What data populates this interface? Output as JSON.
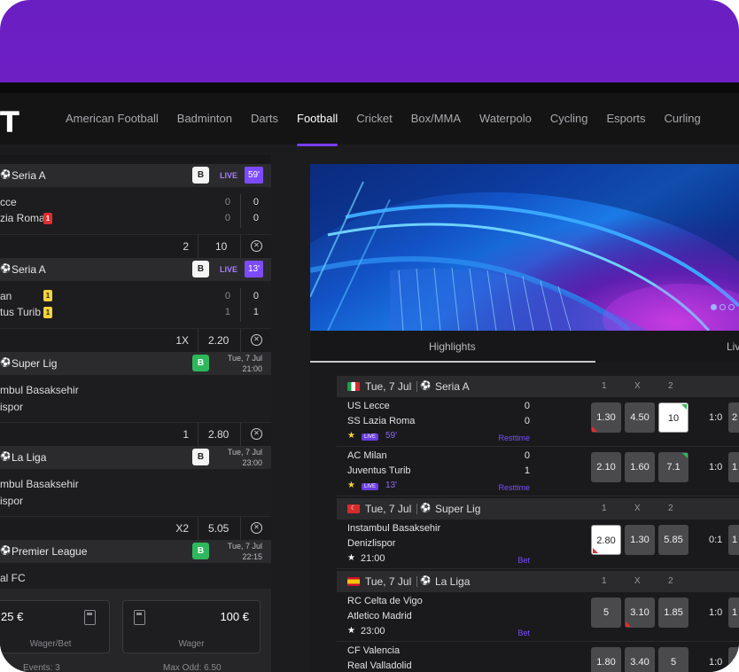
{
  "logo": "T",
  "nav": [
    "American Football",
    "Badminton",
    "Darts",
    "Football",
    "Cricket",
    "Box/MMA",
    "Waterpolo",
    "Cycling",
    "Esports",
    "Curling"
  ],
  "nav_active": "Football",
  "left_matches": [
    {
      "league": "Seria A",
      "tag": "B",
      "live": "LIVE",
      "minute": "59'",
      "team1": "cce",
      "team2": "zia Roma",
      "s1a": "0",
      "s1b": "0",
      "s2a": "0",
      "s2b": "0",
      "card2": "1",
      "sel": "2",
      "odd": "10"
    },
    {
      "league": "Seria A",
      "tag": "B",
      "live": "LIVE",
      "minute": "13'",
      "team1": "an",
      "team2": "tus Turib",
      "s1a": "0",
      "s1b": "0",
      "s2a": "1",
      "s2b": "1",
      "card1": "1",
      "card2": "1",
      "sel": "1X",
      "odd": "2.20"
    },
    {
      "league": "Super Lig",
      "tag": "B",
      "date": "Tue, 7 Jul",
      "time": "21:00",
      "team1": "mbul Basaksehir",
      "team2": "ispor",
      "sel": "1",
      "odd": "2.80"
    },
    {
      "league": "La Liga",
      "tag": "B",
      "date": "Tue, 7 Jul",
      "time": "23:00",
      "team1": "mbul Basaksehir",
      "team2": "ispor",
      "sel": "X2",
      "odd": "5.05"
    },
    {
      "league": "Premier League",
      "tag": "B",
      "date": "Tue, 7 Jul",
      "time": "22:15",
      "team1": "al FC"
    }
  ],
  "wager": {
    "bet_amount": "25 €",
    "bet_label": "Wager/Bet",
    "amount": "100 €",
    "amount_label": "Wager",
    "events_label": "Events",
    "events": "3",
    "max_odd_label": "Max Odd",
    "max_odd": "6.50"
  },
  "tabs": {
    "highlights": "Highlights",
    "live": "Liv"
  },
  "leagues": [
    {
      "date": "Tue, 7 Jul",
      "name": "Seria A",
      "cols": [
        "1",
        "X",
        "2"
      ]
    },
    {
      "date": "Tue, 7 Jul",
      "name": "Super Lig",
      "cols": [
        "1",
        "X",
        "2"
      ]
    },
    {
      "date": "Tue, 7 Jul",
      "name": "La Liga",
      "cols": [
        "1",
        "X",
        "2"
      ]
    }
  ],
  "rows": [
    {
      "t1": "US Lecce",
      "t2": "SS Lazia Roma",
      "s1": "0",
      "s2": "0",
      "live": "LIVE",
      "minute": "59'",
      "note": "Resttime",
      "odds": [
        "1.30",
        "4.50",
        "10"
      ],
      "ratio": "1:0",
      "edge": "2"
    },
    {
      "t1": "AC Milan",
      "t2": "Juventus Turib",
      "s1": "0",
      "s2": "1",
      "live": "LIVE",
      "minute": "13'",
      "note": "Resttime",
      "odds": [
        "2.10",
        "1.60",
        "7.1"
      ],
      "ratio": "1:0",
      "edge": "1"
    },
    {
      "t1": "Instambul Basaksehir",
      "t2": "Denizlispor",
      "time": "21:00",
      "note": "Bet",
      "odds": [
        "2.80",
        "1.30",
        "5.85"
      ],
      "ratio": "0:1",
      "edge": "1"
    },
    {
      "t1": "RC Celta de Vigo",
      "t2": "Atletico Madrid",
      "time": "23:00",
      "note": "Bet",
      "odds": [
        "5",
        "3.10",
        "1.85"
      ],
      "ratio": "1:0",
      "edge": "1"
    },
    {
      "t1": "CF Valencia",
      "t2": "Real Valladolid",
      "odds": [
        "1.80",
        "3.40",
        "5"
      ],
      "ratio": "1:0",
      "edge": "1"
    }
  ]
}
